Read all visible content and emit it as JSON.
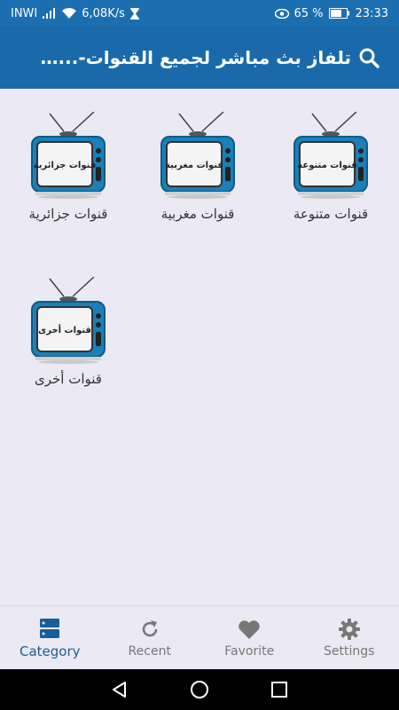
{
  "status_bar": {
    "carrier": "INWI",
    "speed": "6,08K/s",
    "battery": "65 %",
    "time": "23:33"
  },
  "app_bar": {
    "title": "تلفاز بث مباشر لجميع القنوات-...Tulfa",
    "search_icon": "search-icon"
  },
  "categories": [
    {
      "label": "قنوات متنوعة",
      "screen_text": "قنوات متنوعة"
    },
    {
      "label": "قنوات مغربية",
      "screen_text": "قنوات مغربية"
    },
    {
      "label": "قنوات جزائرية",
      "screen_text": "قنوات جزائرية"
    },
    {
      "label": "قنوات أخرى",
      "screen_text": "قنوات أخرى"
    }
  ],
  "bottom_nav": {
    "items": [
      {
        "label": "Category",
        "icon": "category-icon",
        "active": true
      },
      {
        "label": "Recent",
        "icon": "refresh-icon",
        "active": false
      },
      {
        "label": "Favorite",
        "icon": "heart-icon",
        "active": false
      },
      {
        "label": "Settings",
        "icon": "gear-icon",
        "active": false
      }
    ]
  },
  "colors": {
    "primary": "#1a6aab",
    "background": "#ebe9f3",
    "active_nav": "#1a5e98"
  }
}
